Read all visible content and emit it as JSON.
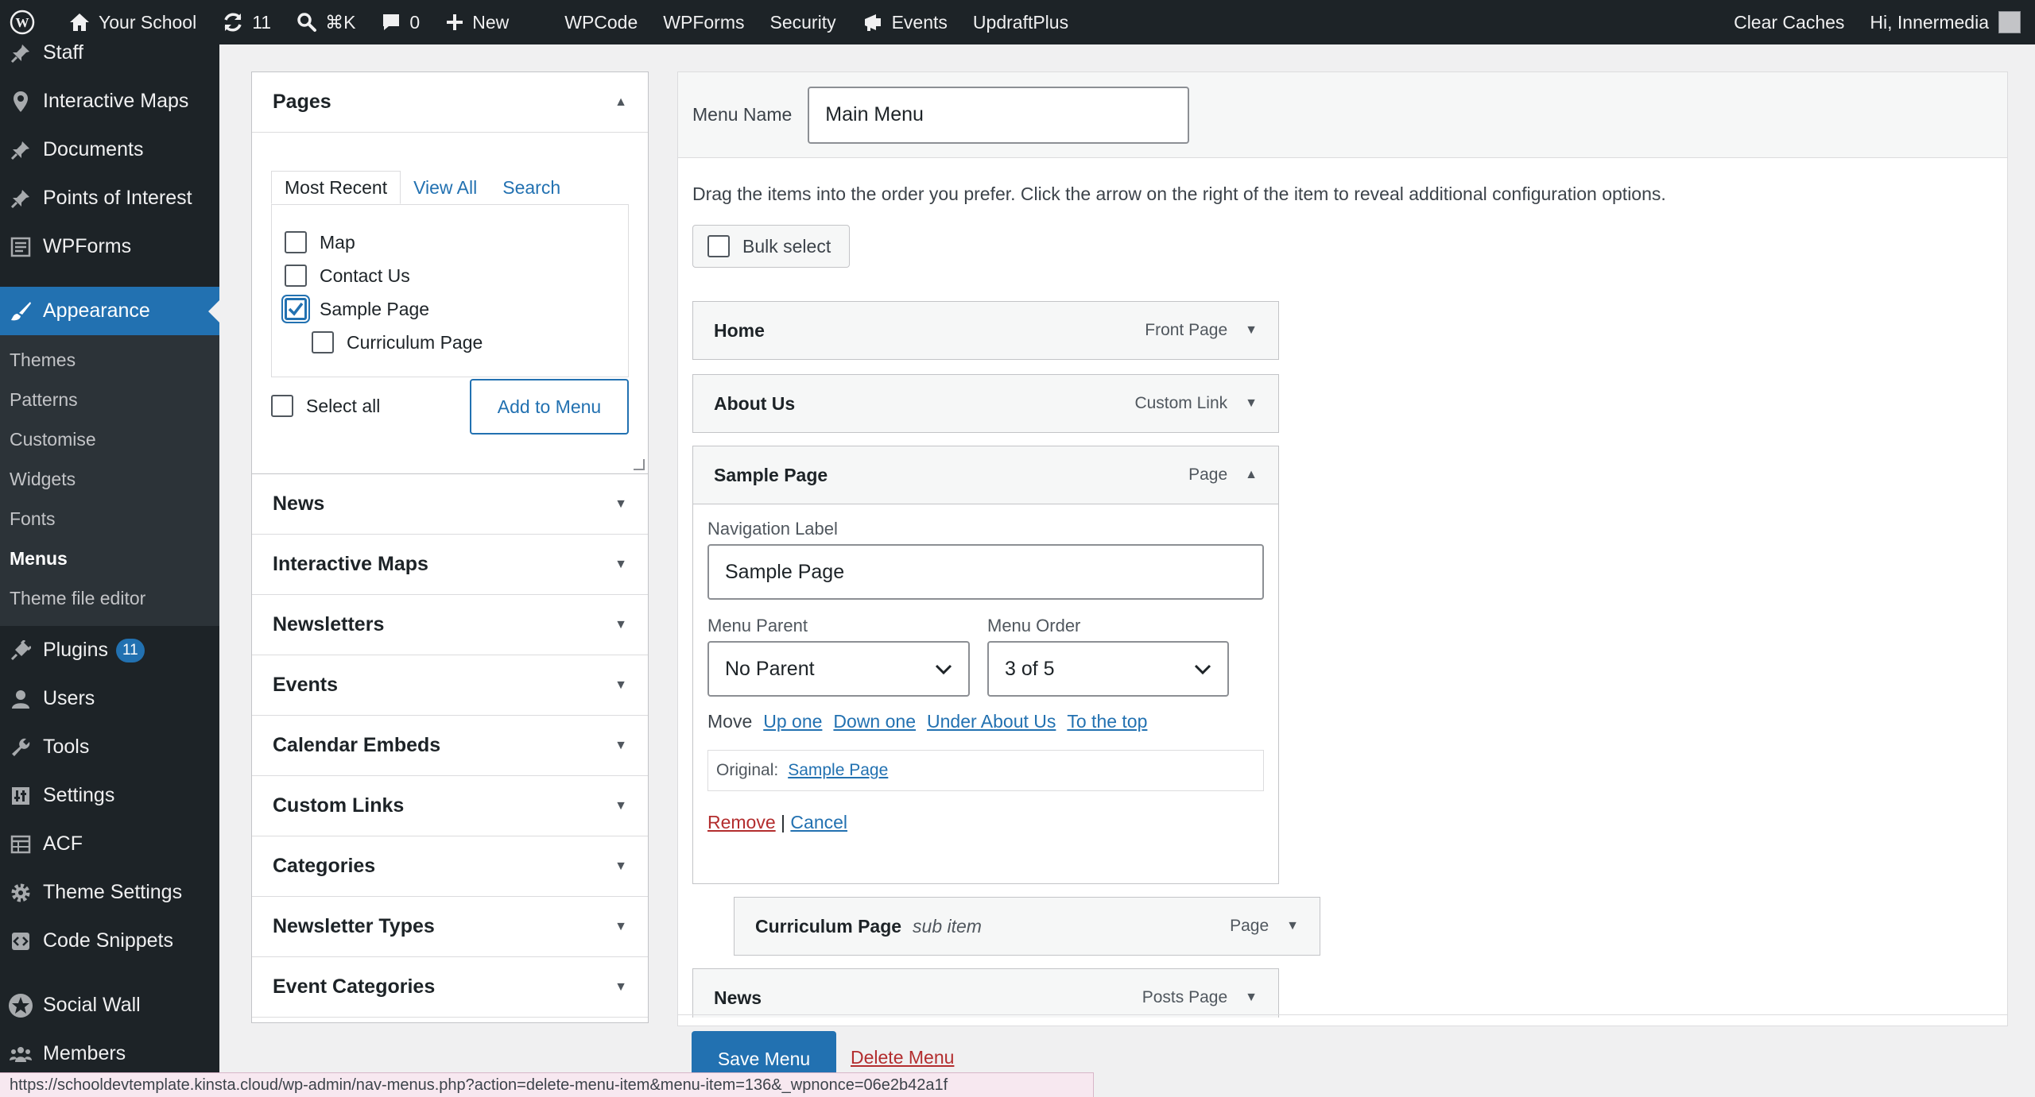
{
  "adminbar": {
    "site_name": "Your School",
    "updates_count": "11",
    "search_shortcut": "⌘K",
    "comments_count": "0",
    "new_label": "New",
    "links": [
      "WPCode",
      "WPForms",
      "Security",
      "Events",
      "UpdraftPlus"
    ],
    "clear_caches": "Clear Caches",
    "greeting": "Hi, Innermedia"
  },
  "sidebar": {
    "items_top": [
      {
        "label": "Staff",
        "icon": "pin-icon"
      },
      {
        "label": "Interactive Maps",
        "icon": "location-icon"
      },
      {
        "label": "Documents",
        "icon": "pin-icon"
      },
      {
        "label": "Points of Interest",
        "icon": "pin-icon"
      },
      {
        "label": "WPForms",
        "icon": "form-icon"
      }
    ],
    "current": {
      "label": "Appearance",
      "icon": "brush-icon"
    },
    "submenu": [
      "Themes",
      "Patterns",
      "Customise",
      "Widgets",
      "Fonts",
      "Menus",
      "Theme file editor"
    ],
    "submenu_current": "Menus",
    "plugins_label": "Plugins",
    "plugins_badge": "11",
    "items_bottom": [
      {
        "label": "Users",
        "icon": "user-icon"
      },
      {
        "label": "Tools",
        "icon": "wrench-icon"
      },
      {
        "label": "Settings",
        "icon": "settings-icon"
      },
      {
        "label": "ACF",
        "icon": "table-icon"
      },
      {
        "label": "Theme Settings",
        "icon": "gear-icon"
      },
      {
        "label": "Code Snippets",
        "icon": "code-icon"
      }
    ],
    "items_extra": [
      {
        "label": "Social Wall",
        "icon": "star-icon"
      },
      {
        "label": "Members",
        "icon": "group-icon"
      }
    ]
  },
  "pages_box": {
    "title": "Pages",
    "tabs": [
      "Most Recent",
      "View All",
      "Search"
    ],
    "items": [
      {
        "label": "Map",
        "checked": false,
        "child": false
      },
      {
        "label": "Contact Us",
        "checked": false,
        "child": false
      },
      {
        "label": "Sample Page",
        "checked": true,
        "child": false
      },
      {
        "label": "Curriculum Page",
        "checked": false,
        "child": true
      }
    ],
    "select_all": "Select all",
    "add_button": "Add to Menu"
  },
  "accordions": [
    "News",
    "Interactive Maps",
    "Newsletters",
    "Events",
    "Calendar Embeds",
    "Custom Links",
    "Categories",
    "Newsletter Types",
    "Event Categories"
  ],
  "menu": {
    "name_label": "Menu Name",
    "name_value": "Main Menu",
    "instructions": "Drag the items into the order you prefer. Click the arrow on the right of the item to reveal additional configuration options.",
    "bulk_select": "Bulk select",
    "items": [
      {
        "title": "Home",
        "type": "Front Page"
      },
      {
        "title": "About Us",
        "type": "Custom Link"
      },
      {
        "title": "Sample Page",
        "type": "Page"
      },
      {
        "title": "Curriculum Page",
        "sub": "sub item",
        "type": "Page"
      },
      {
        "title": "News",
        "type": "Posts Page"
      }
    ],
    "edit": {
      "nav_label_label": "Navigation Label",
      "nav_label_value": "Sample Page",
      "parent_label": "Menu Parent",
      "parent_value": "No Parent",
      "order_label": "Menu Order",
      "order_value": "3 of 5",
      "move_label": "Move",
      "move_links": [
        "Up one",
        "Down one",
        "Under About Us",
        "To the top"
      ],
      "original_label": "Original:",
      "original_link": "Sample Page",
      "remove": "Remove",
      "separator": "|",
      "cancel": "Cancel"
    },
    "save_button": "Save Menu",
    "delete_link": "Delete Menu"
  },
  "status_url": "https://schooldevtemplate.kinsta.cloud/wp-admin/nav-menus.php?action=delete-menu-item&menu-item=136&_wpnonce=06e2b42a1f"
}
